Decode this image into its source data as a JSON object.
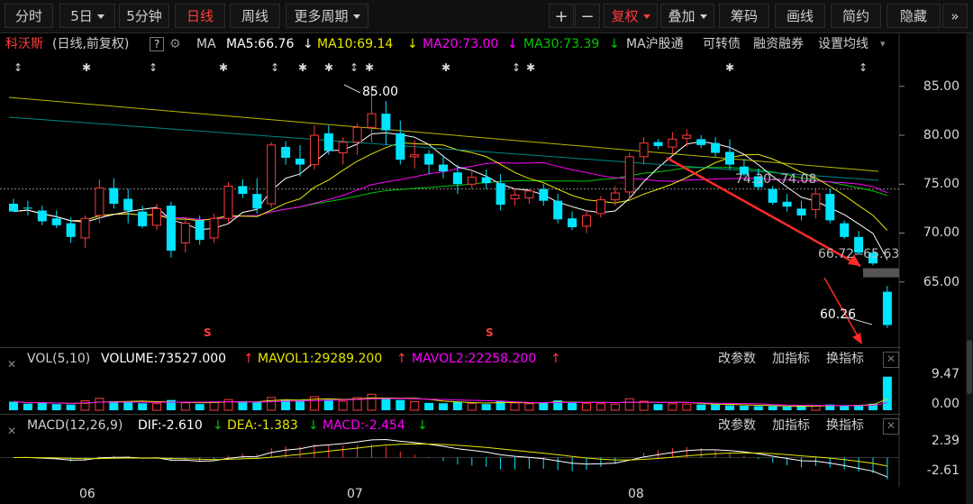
{
  "toolbar": {
    "tabs": [
      {
        "label": "分时"
      },
      {
        "label": "5日"
      },
      {
        "label": "5分钟"
      },
      {
        "label": "日线"
      },
      {
        "label": "周线"
      },
      {
        "label": "更多周期"
      }
    ],
    "active_tab": "日线",
    "zoom_in": "+",
    "zoom_out": "−",
    "fuquan": "复权",
    "overlay": "叠加",
    "chips": "筹码",
    "draw": "画线",
    "simple": "简约",
    "hide": "隐藏",
    "collapse": "»"
  },
  "info": {
    "stock_name": "科沃斯",
    "period_note": "(日线,前复权)",
    "help": "?",
    "ma_label": "MA",
    "ma5": "MA5:66.76",
    "ma10": "MA10:69.14",
    "ma20": "MA20:73.00",
    "ma30": "MA30:73.39",
    "hsgt": "MA沪股通",
    "convertible": "可转债",
    "margin": "融资融券",
    "set_ma": "设置均线"
  },
  "price_axis": [
    "85.00",
    "80.00",
    "75.00",
    "70.00",
    "65.00"
  ],
  "price_annotations": {
    "high": "85.00",
    "low": "60.26",
    "range1": "74.30--74.08",
    "range2": "66.72--65.63",
    "marker_s": "S"
  },
  "volume_panel": {
    "title": "VOL(5,10)",
    "volume": "VOLUME:73527.000",
    "mavol1": "MAVOL1:29289.200",
    "mavol2": "MAVOL2:22258.200",
    "arrow": "↑",
    "axis_top": "9.47",
    "axis_bottom": "0.00",
    "change_params": "改参数",
    "add_indicator": "加指标",
    "switch_indicator": "换指标",
    "close": "✕"
  },
  "macd_panel": {
    "title": "MACD(12,26,9)",
    "dif": "DIF:-2.610",
    "dea": "DEA:-1.383",
    "macd": "MACD:-2.454",
    "arrow_down": "↓",
    "axis_top": "2.39",
    "axis_bottom": "-2.61",
    "change_params": "改参数",
    "add_indicator": "加指标",
    "switch_indicator": "换指标",
    "close": "✕"
  },
  "dates": [
    "06",
    "07",
    "08"
  ],
  "colors": {
    "up": "#ff3b3b",
    "down": "#00e5ff",
    "ma5": "#ffffff",
    "ma10": "#e6e600",
    "ma20": "#ff00ff",
    "ma30": "#00c800"
  },
  "chart_data": {
    "type": "candlestick",
    "ylim": [
      57,
      88
    ],
    "y_ticks": [
      65,
      70,
      75,
      80,
      85
    ],
    "candles": [
      [
        73.0,
        73.5,
        72.5,
        72.2
      ],
      [
        72.6,
        73.3,
        71.8,
        72.5
      ],
      [
        72.3,
        72.8,
        70.8,
        71.2
      ],
      [
        71.5,
        72.3,
        70.5,
        70.8
      ],
      [
        71.0,
        71.6,
        69.0,
        69.6
      ],
      [
        69.5,
        71.8,
        68.5,
        71.5
      ],
      [
        71.8,
        75.5,
        71.0,
        74.6
      ],
      [
        74.6,
        75.6,
        72.5,
        73.0
      ],
      [
        73.5,
        74.5,
        71.0,
        72.3
      ],
      [
        72.2,
        72.8,
        70.5,
        70.7
      ],
      [
        70.8,
        73.0,
        70.3,
        72.5
      ],
      [
        72.8,
        73.2,
        67.5,
        68.2
      ],
      [
        69.0,
        71.5,
        68.0,
        71.0
      ],
      [
        71.3,
        71.8,
        68.8,
        69.3
      ],
      [
        69.5,
        72.0,
        69.0,
        71.5
      ],
      [
        71.5,
        75.2,
        71.0,
        74.8
      ],
      [
        74.8,
        75.5,
        73.6,
        74.0
      ],
      [
        74.0,
        75.6,
        72.0,
        72.5
      ],
      [
        73.0,
        79.3,
        72.6,
        79.0
      ],
      [
        78.8,
        79.4,
        77.0,
        77.7
      ],
      [
        77.6,
        79.0,
        75.8,
        77.0
      ],
      [
        77.0,
        81.0,
        76.5,
        80.0
      ],
      [
        80.2,
        81.0,
        78.0,
        78.4
      ],
      [
        78.2,
        79.8,
        77.0,
        79.3
      ],
      [
        79.3,
        81.2,
        78.0,
        80.8
      ],
      [
        80.8,
        85.0,
        79.3,
        82.2
      ],
      [
        82.2,
        83.5,
        79.0,
        80.5
      ],
      [
        80.2,
        81.5,
        77.0,
        77.5
      ],
      [
        77.8,
        79.5,
        76.6,
        78.0
      ],
      [
        78.1,
        78.5,
        76.0,
        77.0
      ],
      [
        77.0,
        78.0,
        75.6,
        76.3
      ],
      [
        76.2,
        77.0,
        74.0,
        75.0
      ],
      [
        75.0,
        76.5,
        74.5,
        75.7
      ],
      [
        75.7,
        76.5,
        74.5,
        75.1
      ],
      [
        75.1,
        76.0,
        72.3,
        72.9
      ],
      [
        73.5,
        74.6,
        72.8,
        73.9
      ],
      [
        73.6,
        74.5,
        73.0,
        74.3
      ],
      [
        74.5,
        75.0,
        72.8,
        73.3
      ],
      [
        73.3,
        74.0,
        71.0,
        71.4
      ],
      [
        71.5,
        72.2,
        70.3,
        70.6
      ],
      [
        70.7,
        72.3,
        70.0,
        71.8
      ],
      [
        72.0,
        73.8,
        71.6,
        73.4
      ],
      [
        73.4,
        74.8,
        72.8,
        74.1
      ],
      [
        74.2,
        78.2,
        73.5,
        77.8
      ],
      [
        77.8,
        79.8,
        77.0,
        79.2
      ],
      [
        79.3,
        79.6,
        78.6,
        78.9
      ],
      [
        78.8,
        80.3,
        78.1,
        79.6
      ],
      [
        79.7,
        80.6,
        78.8,
        80.0
      ],
      [
        79.6,
        80.0,
        78.7,
        79.0
      ],
      [
        79.2,
        79.8,
        77.8,
        78.2
      ],
      [
        78.3,
        79.6,
        76.5,
        77.0
      ],
      [
        76.8,
        77.6,
        75.8,
        76.0
      ],
      [
        75.8,
        76.6,
        74.4,
        74.7
      ],
      [
        74.5,
        74.8,
        72.9,
        73.1
      ],
      [
        73.2,
        74.0,
        72.2,
        72.7
      ],
      [
        72.5,
        73.3,
        71.3,
        71.8
      ],
      [
        72.4,
        74.6,
        71.5,
        74.0
      ],
      [
        74.0,
        74.5,
        71.0,
        71.3
      ],
      [
        71.0,
        71.3,
        69.4,
        69.6
      ],
      [
        69.6,
        70.2,
        67.8,
        68.0
      ],
      [
        68.0,
        68.3,
        66.7,
        66.9
      ],
      [
        64.0,
        64.6,
        60.3,
        60.6
      ]
    ],
    "volume_max": 9.47,
    "volumes": [
      2.1,
      1.6,
      1.8,
      1.5,
      1.4,
      2.3,
      2.9,
      2.2,
      2.0,
      1.7,
      1.6,
      2.5,
      1.8,
      1.5,
      1.9,
      2.6,
      2.2,
      2.1,
      3.1,
      2.6,
      2.4,
      3.3,
      2.6,
      2.2,
      3.1,
      3.9,
      3.0,
      2.5,
      2.1,
      1.8,
      1.7,
      2.1,
      1.7,
      1.5,
      2.3,
      1.8,
      1.6,
      1.9,
      2.4,
      2.1,
      1.7,
      1.6,
      1.5,
      2.8,
      2.2,
      1.5,
      1.6,
      1.5,
      1.4,
      1.4,
      1.2,
      1.1,
      1.0,
      1.0,
      0.9,
      1.0,
      1.2,
      1.4,
      1.2,
      1.3,
      1.6,
      8.2
    ],
    "macd_ylim": [
      -2.61,
      2.39
    ]
  }
}
